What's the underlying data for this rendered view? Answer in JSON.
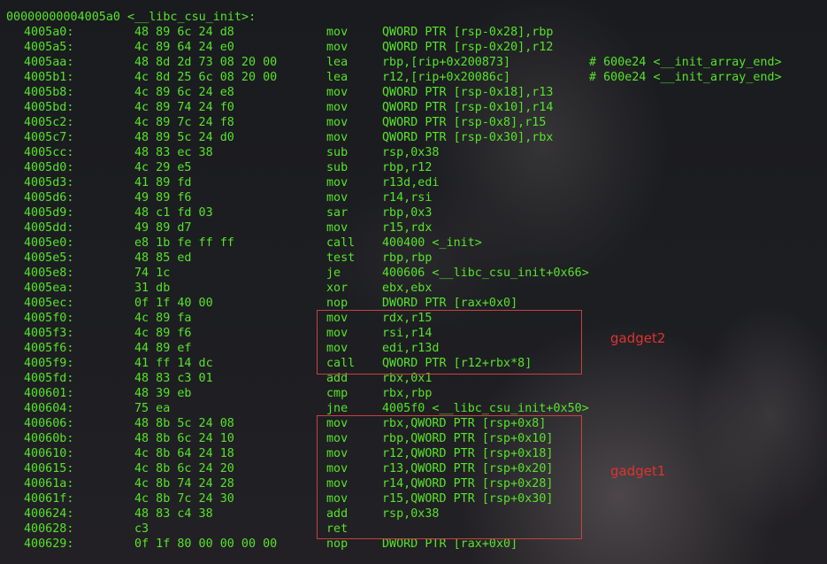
{
  "header": "00000000004005a0 <__libc_csu_init>:",
  "rows": [
    {
      "addr": "4005a0:",
      "bytes": "48 89 6c 24 d8",
      "mn": "mov",
      "op": "QWORD PTR [rsp-0x28],rbp",
      "cm": ""
    },
    {
      "addr": "4005a5:",
      "bytes": "4c 89 64 24 e0",
      "mn": "mov",
      "op": "QWORD PTR [rsp-0x20],r12",
      "cm": ""
    },
    {
      "addr": "4005aa:",
      "bytes": "48 8d 2d 73 08 20 00",
      "mn": "lea",
      "op": "rbp,[rip+0x200873]",
      "cm": "# 600e24 <__init_array_end>"
    },
    {
      "addr": "4005b1:",
      "bytes": "4c 8d 25 6c 08 20 00",
      "mn": "lea",
      "op": "r12,[rip+0x20086c]",
      "cm": "# 600e24 <__init_array_end>"
    },
    {
      "addr": "4005b8:",
      "bytes": "4c 89 6c 24 e8",
      "mn": "mov",
      "op": "QWORD PTR [rsp-0x18],r13",
      "cm": ""
    },
    {
      "addr": "4005bd:",
      "bytes": "4c 89 74 24 f0",
      "mn": "mov",
      "op": "QWORD PTR [rsp-0x10],r14",
      "cm": ""
    },
    {
      "addr": "4005c2:",
      "bytes": "4c 89 7c 24 f8",
      "mn": "mov",
      "op": "QWORD PTR [rsp-0x8],r15",
      "cm": ""
    },
    {
      "addr": "4005c7:",
      "bytes": "48 89 5c 24 d0",
      "mn": "mov",
      "op": "QWORD PTR [rsp-0x30],rbx",
      "cm": ""
    },
    {
      "addr": "4005cc:",
      "bytes": "48 83 ec 38",
      "mn": "sub",
      "op": "rsp,0x38",
      "cm": ""
    },
    {
      "addr": "4005d0:",
      "bytes": "4c 29 e5",
      "mn": "sub",
      "op": "rbp,r12",
      "cm": ""
    },
    {
      "addr": "4005d3:",
      "bytes": "41 89 fd",
      "mn": "mov",
      "op": "r13d,edi",
      "cm": ""
    },
    {
      "addr": "4005d6:",
      "bytes": "49 89 f6",
      "mn": "mov",
      "op": "r14,rsi",
      "cm": ""
    },
    {
      "addr": "4005d9:",
      "bytes": "48 c1 fd 03",
      "mn": "sar",
      "op": "rbp,0x3",
      "cm": ""
    },
    {
      "addr": "4005dd:",
      "bytes": "49 89 d7",
      "mn": "mov",
      "op": "r15,rdx",
      "cm": ""
    },
    {
      "addr": "4005e0:",
      "bytes": "e8 1b fe ff ff",
      "mn": "call",
      "op": "400400 <_init>",
      "cm": ""
    },
    {
      "addr": "4005e5:",
      "bytes": "48 85 ed",
      "mn": "test",
      "op": "rbp,rbp",
      "cm": ""
    },
    {
      "addr": "4005e8:",
      "bytes": "74 1c",
      "mn": "je",
      "op": "400606 <__libc_csu_init+0x66>",
      "cm": ""
    },
    {
      "addr": "4005ea:",
      "bytes": "31 db",
      "mn": "xor",
      "op": "ebx,ebx",
      "cm": ""
    },
    {
      "addr": "4005ec:",
      "bytes": "0f 1f 40 00",
      "mn": "nop",
      "op": "DWORD PTR [rax+0x0]",
      "cm": ""
    },
    {
      "addr": "4005f0:",
      "bytes": "4c 89 fa",
      "mn": "mov",
      "op": "rdx,r15",
      "cm": ""
    },
    {
      "addr": "4005f3:",
      "bytes": "4c 89 f6",
      "mn": "mov",
      "op": "rsi,r14",
      "cm": ""
    },
    {
      "addr": "4005f6:",
      "bytes": "44 89 ef",
      "mn": "mov",
      "op": "edi,r13d",
      "cm": ""
    },
    {
      "addr": "4005f9:",
      "bytes": "41 ff 14 dc",
      "mn": "call",
      "op": "QWORD PTR [r12+rbx*8]",
      "cm": ""
    },
    {
      "addr": "4005fd:",
      "bytes": "48 83 c3 01",
      "mn": "add",
      "op": "rbx,0x1",
      "cm": ""
    },
    {
      "addr": "400601:",
      "bytes": "48 39 eb",
      "mn": "cmp",
      "op": "rbx,rbp",
      "cm": ""
    },
    {
      "addr": "400604:",
      "bytes": "75 ea",
      "mn": "jne",
      "op": "4005f0 <__libc_csu_init+0x50>",
      "cm": ""
    },
    {
      "addr": "400606:",
      "bytes": "48 8b 5c 24 08",
      "mn": "mov",
      "op": "rbx,QWORD PTR [rsp+0x8]",
      "cm": ""
    },
    {
      "addr": "40060b:",
      "bytes": "48 8b 6c 24 10",
      "mn": "mov",
      "op": "rbp,QWORD PTR [rsp+0x10]",
      "cm": ""
    },
    {
      "addr": "400610:",
      "bytes": "4c 8b 64 24 18",
      "mn": "mov",
      "op": "r12,QWORD PTR [rsp+0x18]",
      "cm": ""
    },
    {
      "addr": "400615:",
      "bytes": "4c 8b 6c 24 20",
      "mn": "mov",
      "op": "r13,QWORD PTR [rsp+0x20]",
      "cm": ""
    },
    {
      "addr": "40061a:",
      "bytes": "4c 8b 74 24 28",
      "mn": "mov",
      "op": "r14,QWORD PTR [rsp+0x28]",
      "cm": ""
    },
    {
      "addr": "40061f:",
      "bytes": "4c 8b 7c 24 30",
      "mn": "mov",
      "op": "r15,QWORD PTR [rsp+0x30]",
      "cm": ""
    },
    {
      "addr": "400624:",
      "bytes": "48 83 c4 38",
      "mn": "add",
      "op": "rsp,0x38",
      "cm": ""
    },
    {
      "addr": "400628:",
      "bytes": "c3",
      "mn": "ret",
      "op": "",
      "cm": ""
    },
    {
      "addr": "400629:",
      "bytes": "0f 1f 80 00 00 00 00",
      "mn": "nop",
      "op": "DWORD PTR [rax+0x0]",
      "cm": ""
    }
  ],
  "annotations": {
    "gadget2": "gadget2",
    "gadget1": "gadget1"
  },
  "colors": {
    "text": "#56e32a",
    "annotation": "#e0322f",
    "box": "#c8413f",
    "background": "#1b1c20"
  }
}
